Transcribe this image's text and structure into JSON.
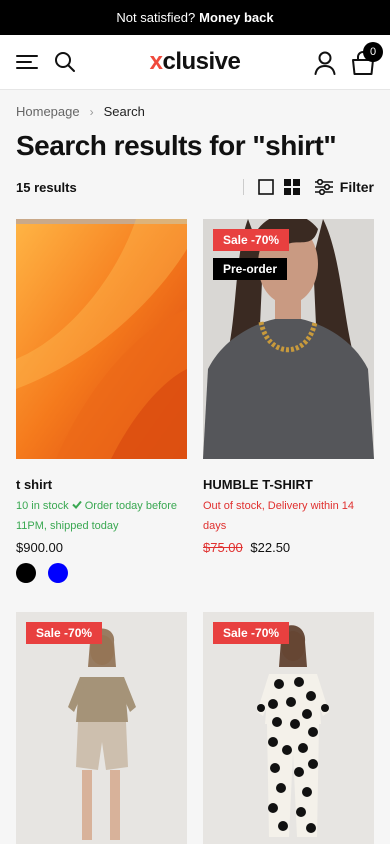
{
  "announcement": {
    "prefix": "Not satisfied?",
    "bold": "Money back"
  },
  "header": {
    "logo_x": "x",
    "logo_rest": "clusive",
    "cart_count": "0"
  },
  "breadcrumb": {
    "home": "Homepage",
    "current": "Search"
  },
  "page_title": "Search results for \"shirt\"",
  "results_count": "15 results",
  "filter_label": "Filter",
  "products": [
    {
      "name": "t shirt",
      "stock": "10 in stock",
      "stock_note": "Order today before 11PM, shipped today",
      "price": "$900.00",
      "swatches": [
        "#000000",
        "#0000ff"
      ]
    },
    {
      "name": "HUMBLE T-SHIRT",
      "badge_sale": "Sale -70%",
      "badge_pre": "Pre-order",
      "stock": "Out of stock, Delivery within 14 days",
      "old_price": "$75.00",
      "price": "$22.50"
    },
    {
      "badge_sale": "Sale -70%"
    },
    {
      "badge_sale": "Sale -70%"
    }
  ],
  "colors": {
    "accent": "#f04a3c",
    "sale": "#e8403f",
    "in_stock": "#3aa852",
    "out_stock": "#e0302f"
  }
}
